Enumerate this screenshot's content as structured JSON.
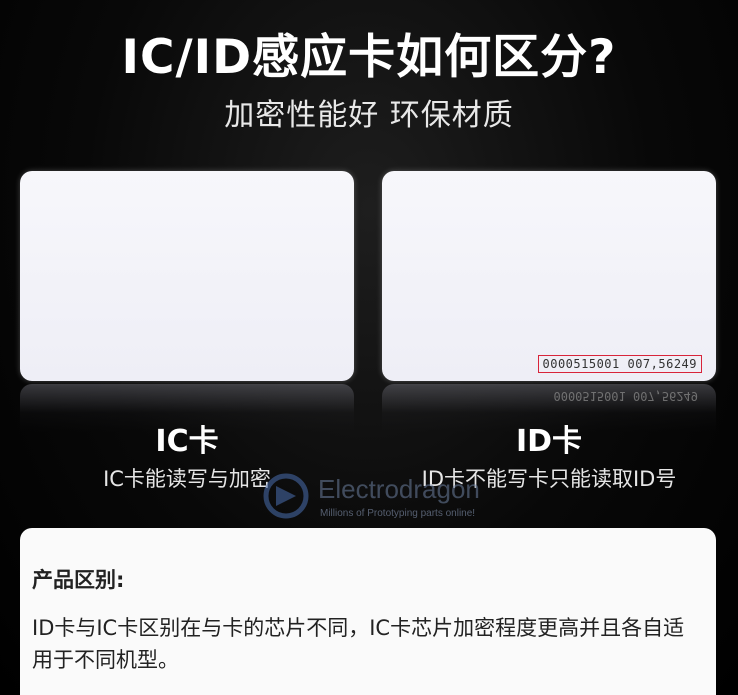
{
  "header": {
    "title": "IC/ID感应卡如何区分?",
    "subtitle": "加密性能好 环保材质"
  },
  "cards": [
    {
      "label": "IC卡",
      "description": "IC卡能读写与加密"
    },
    {
      "label": "ID卡",
      "description": "ID卡不能写卡只能读取ID号",
      "card_number": "0000515001 007,56249"
    }
  ],
  "watermark": {
    "name": "Electrodragon",
    "tagline": "Millions of Prototyping parts online!"
  },
  "info_panel": {
    "heading": "产品区别:",
    "body": "ID卡与IC卡区别在与卡的芯片不同，IC卡芯片加密程度更高并且各自适用于不同机型。"
  },
  "colors": {
    "background": "#000000",
    "card": "#f4f4fa",
    "highlight_box": "#d8243a",
    "panel": "#fafafa"
  }
}
